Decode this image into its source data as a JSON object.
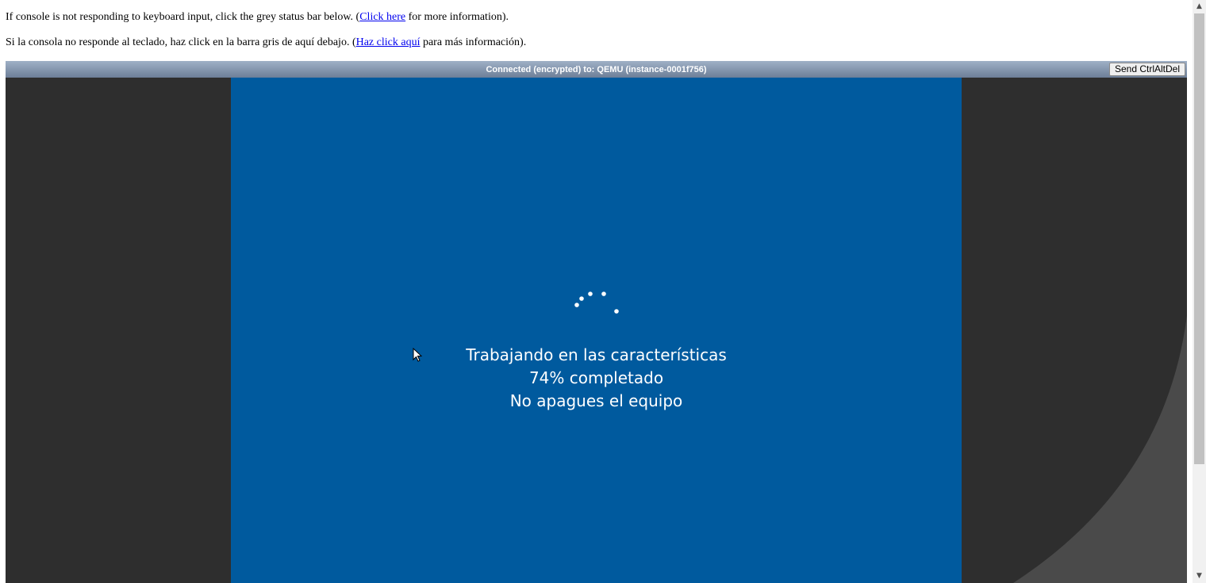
{
  "notices": {
    "english": {
      "before": "If console is not responding to keyboard input, click the grey status bar below. (",
      "link": "Click here",
      "after": " for more information)."
    },
    "spanish": {
      "before": "Si la consola no responde al teclado, haz click en la barra gris de aquí debajo. (",
      "link": "Haz click aquí",
      "after": " para más información)."
    }
  },
  "status_bar": {
    "text": "Connected (encrypted) to: QEMU (instance-0001f756)",
    "send_cad_label": "Send CtrlAltDel"
  },
  "vm_screen": {
    "line1": "Trabajando en las características",
    "line2": "74% completado",
    "line3": "No apagues el equipo",
    "progress_percent": 74,
    "background_color": "#005a9e",
    "spinner_icon": "loading-dots-icon"
  },
  "colors": {
    "console_background": "#2e2e2e",
    "link": "#0000ee"
  },
  "scrollbar": {
    "up_arrow": "▲",
    "down_arrow": "▼"
  }
}
